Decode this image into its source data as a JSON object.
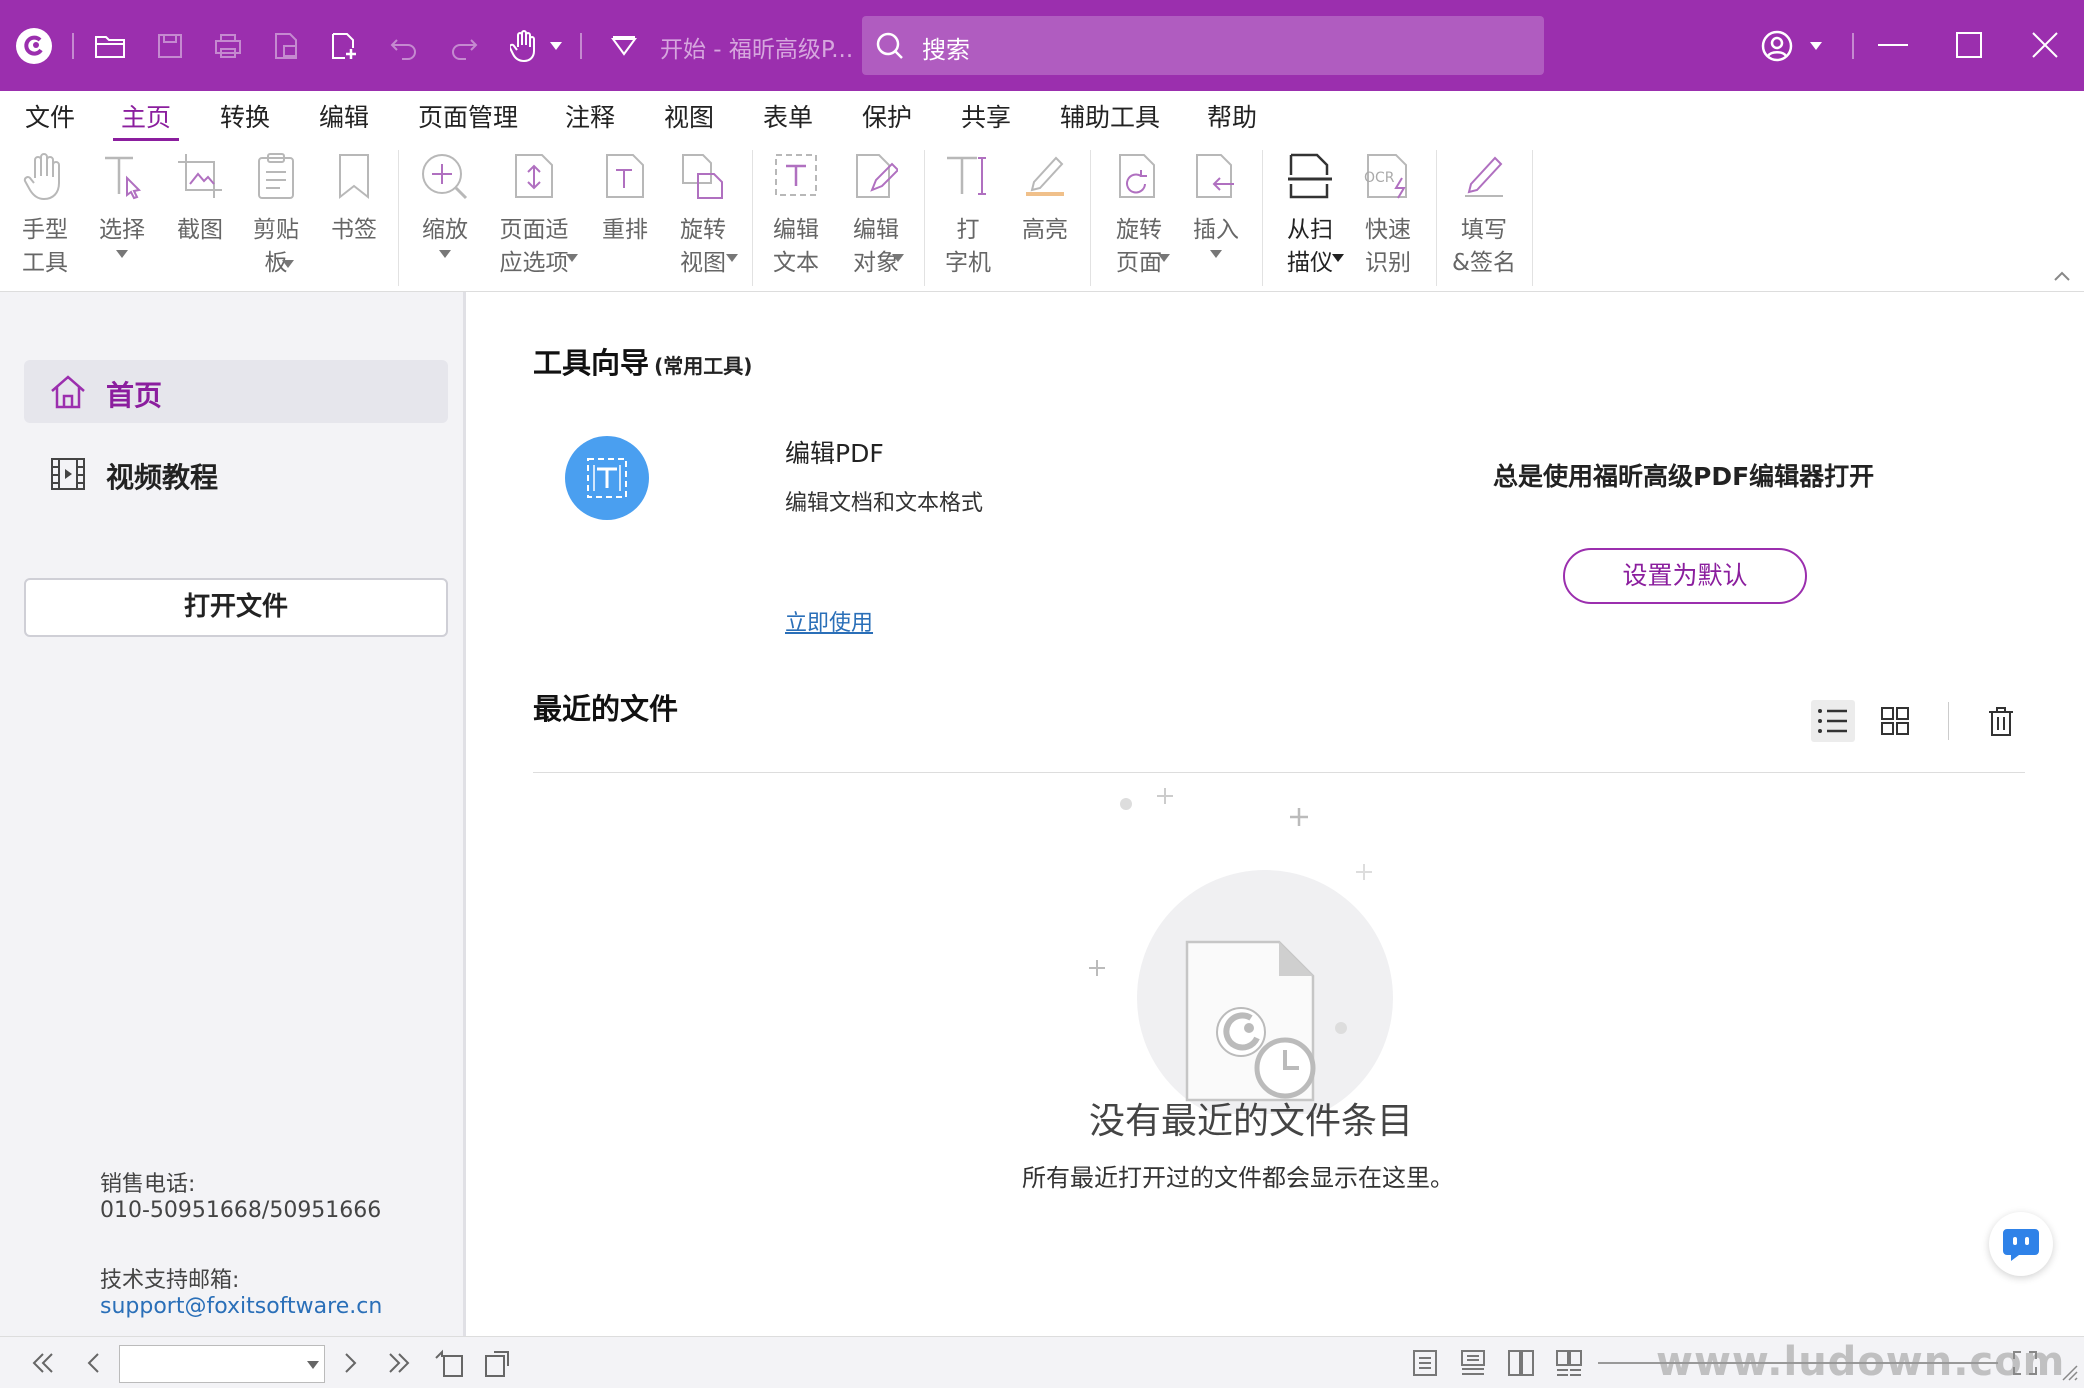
{
  "titlebar": {
    "doc_tab": "开始 - 福昕高级P...",
    "search_placeholder": "搜索",
    "accent": "#9b2fae"
  },
  "menu": {
    "tabs": [
      "文件",
      "主页",
      "转换",
      "编辑",
      "页面管理",
      "注释",
      "视图",
      "表单",
      "保护",
      "共享",
      "辅助工具",
      "帮助"
    ],
    "active": "主页"
  },
  "ribbon": {
    "hand": "手型\n工具",
    "select": "选择",
    "screenshot": "截图",
    "clipboard": "剪贴\n板",
    "bookmark": "书签",
    "zoom": "缩放",
    "fit": "页面适\n应选项",
    "reflow": "重排",
    "rotate_view": "旋转\n视图",
    "edit_text": "编辑\n文本",
    "edit_object": "编辑\n对象",
    "typewriter": "打\n字机",
    "highlight": "高亮",
    "rotate_page": "旋转\n页面",
    "insert": "插入",
    "scan": "从扫\n描仪",
    "ocr": "快速\n识别",
    "fill_sign": "填写\n&签名"
  },
  "sidebar": {
    "home": "首页",
    "tutorial": "视频教程",
    "open_file": "打开文件",
    "sales_label": "销售电话:",
    "sales_phone": "010-50951668/50951666",
    "support_label": "技术支持邮箱:",
    "support_email": "support@foxitsoftware.cn"
  },
  "main": {
    "tools_title": "工具向导",
    "tools_subtitle": "(常用工具)",
    "tool_name": "编辑PDF",
    "tool_desc": "编辑文档和文本格式",
    "use_now": "立即使用",
    "default_text": "总是使用福昕高级PDF编辑器打开",
    "set_default": "设置为默认",
    "recent_title": "最近的文件",
    "empty_title": "没有最近的文件条目",
    "empty_desc": "所有最近打开过的文件都会显示在这里。"
  },
  "statusbar": {
    "page_value": "",
    "watermark": "www.ludown.com"
  }
}
